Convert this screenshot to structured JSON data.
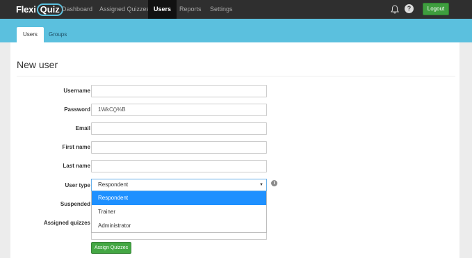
{
  "header": {
    "logo_part1": "Flexi",
    "logo_part2": "Quiz",
    "nav": [
      "Dashboard",
      "Assigned Quizzes",
      "Users",
      "Reports",
      "Settings"
    ],
    "active_nav": "Users",
    "logout_label": "Logout",
    "help_glyph": "?"
  },
  "subnav": {
    "tabs": [
      "Users",
      "Groups"
    ],
    "active_tab": "Users"
  },
  "form": {
    "title": "New user",
    "fields": {
      "username": {
        "label": "Username",
        "value": ""
      },
      "password": {
        "label": "Password",
        "value": "1WkC()%B"
      },
      "email": {
        "label": "Email",
        "value": ""
      },
      "first_name": {
        "label": "First name",
        "value": ""
      },
      "last_name": {
        "label": "Last name",
        "value": ""
      },
      "user_type": {
        "label": "User type",
        "value": "Respondent",
        "options": [
          "Respondent",
          "Trainer",
          "Administrator"
        ],
        "highlighted": "Respondent"
      },
      "suspended": {
        "label": "Suspended"
      },
      "assigned_quizzes": {
        "label": "Assigned quizzes"
      }
    },
    "assign_button_label": "Assign Quizzes",
    "info_glyph": "i"
  },
  "icons": {
    "notifications": "bell-icon",
    "help": "help-icon",
    "info": "info-icon",
    "select_caret": "caret-down-icon"
  },
  "colors": {
    "topbar": "#2f2f2f",
    "subbar": "#5bc0de",
    "accent_green": "#44a744",
    "dropdown_highlight": "#1e90ff"
  }
}
